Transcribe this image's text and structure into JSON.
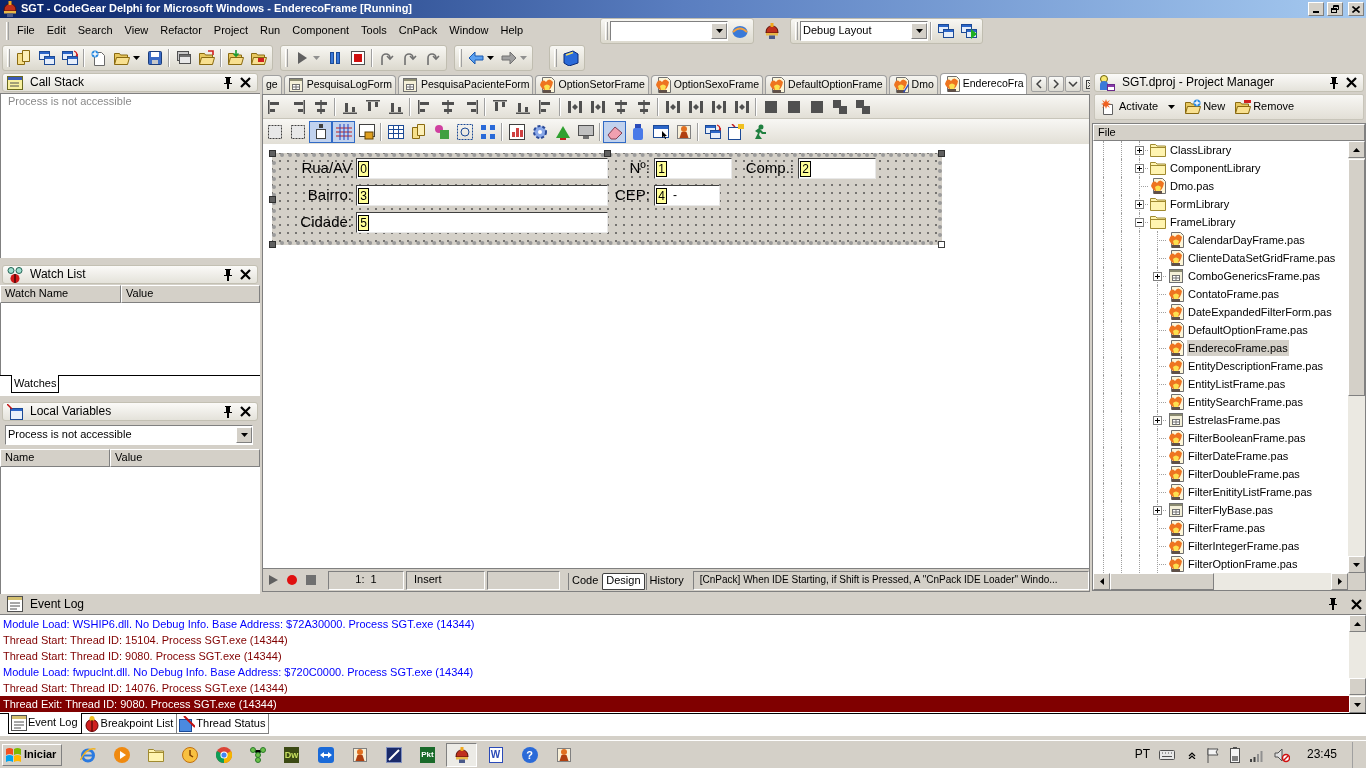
{
  "window": {
    "title": "SGT - CodeGear Delphi for Microsoft Windows - EnderecoFrame [Running]"
  },
  "menu": [
    "File",
    "Edit",
    "Search",
    "View",
    "Refactor",
    "Project",
    "Run",
    "Component",
    "Tools",
    "CnPack",
    "Window",
    "Help"
  ],
  "layout_selector": {
    "value": "Debug Layout"
  },
  "call_stack": {
    "title": "Call Stack",
    "message": "Process is not accessible"
  },
  "watch_list": {
    "title": "Watch List",
    "columns": [
      "Watch Name",
      "Value"
    ],
    "tabs": [
      {
        "label": "Watches",
        "selected": true
      }
    ]
  },
  "local_variables": {
    "title": "Local Variables",
    "scope": {
      "value": "Process is not accessible"
    },
    "columns": [
      "Name",
      "Value"
    ]
  },
  "editor_tabs": [
    {
      "label": "ge",
      "kind": "clipped",
      "selected": false
    },
    {
      "label": "PesquisaLogForm",
      "kind": "form",
      "selected": false
    },
    {
      "label": "PesquisaPacienteForm",
      "kind": "form",
      "selected": false
    },
    {
      "label": "OptionSetorFrame",
      "kind": "unit",
      "selected": false
    },
    {
      "label": "OptionSexoFrame",
      "kind": "unit",
      "selected": false
    },
    {
      "label": "DefaultOptionFrame",
      "kind": "unit",
      "selected": false
    },
    {
      "label": "Dmo",
      "kind": "datamodule",
      "selected": false
    },
    {
      "label": "EnderecoFra",
      "kind": "unit",
      "selected": true
    }
  ],
  "designer_toggles": [
    {
      "pressed": false
    },
    {
      "pressed": false
    },
    {
      "pressed": true
    },
    {
      "pressed": true
    },
    {
      "pressed": false
    },
    {
      "pressed": false
    },
    {
      "pressed": false
    },
    {
      "pressed": false
    },
    {
      "pressed": false
    },
    {
      "pressed": false
    },
    {
      "pressed": false
    },
    {
      "pressed": false
    },
    {
      "pressed": false
    },
    {
      "pressed": false
    },
    {
      "pressed": true
    },
    {
      "pressed": false
    },
    {
      "pressed": false
    },
    {
      "pressed": false
    },
    {
      "pressed": false
    },
    {
      "pressed": false
    },
    {
      "pressed": false
    }
  ],
  "form_designer": {
    "rows": [
      {
        "fields": [
          {
            "label": "Rua/AV",
            "tab_order": "0"
          },
          {
            "label": "Nº:",
            "tab_order": "1"
          },
          {
            "label": "Comp.:",
            "tab_order": "2"
          }
        ]
      },
      {
        "fields": [
          {
            "label": "Bairro:",
            "tab_order": "3"
          },
          {
            "label": "CEP:",
            "tab_order": "4",
            "value": "-"
          }
        ]
      },
      {
        "fields": [
          {
            "label": "Cidade:",
            "tab_order": "5"
          }
        ]
      }
    ]
  },
  "editor_status": {
    "position": "1:  1",
    "mode": "Insert",
    "views": [
      {
        "label": "Code",
        "selected": false
      },
      {
        "label": "Design",
        "selected": true
      },
      {
        "label": "History",
        "selected": false
      }
    ],
    "message": "[CnPack] When IDE Starting, if Shift is Pressed, A \"CnPack IDE Loader\" Windo..."
  },
  "project_manager": {
    "title": "SGT.dproj - Project Manager",
    "toolbar": [
      {
        "label": "Activate",
        "kind": "activate"
      },
      {
        "label": "New",
        "kind": "new"
      },
      {
        "label": "Remove",
        "kind": "remove"
      }
    ],
    "column": "File",
    "tree": [
      {
        "label": "ClassLibrary",
        "kind": "folder",
        "expanded": false,
        "selected": false
      },
      {
        "label": "ComponentLibrary",
        "kind": "folder",
        "expanded": false,
        "selected": false
      },
      {
        "label": "Dmo.pas",
        "kind": "unit",
        "selected": false
      },
      {
        "label": "FormLibrary",
        "kind": "folder",
        "expanded": false,
        "selected": false
      },
      {
        "label": "FrameLibrary",
        "kind": "folder",
        "expanded": true,
        "selected": false,
        "children": [
          {
            "label": "CalendarDayFrame.pas",
            "kind": "unit",
            "selected": false
          },
          {
            "label": "ClienteDataSetGridFrame.pas",
            "kind": "unit",
            "selected": false
          },
          {
            "label": "ComboGenericsFrame.pas",
            "kind": "form",
            "expanded": false,
            "selected": false
          },
          {
            "label": "ContatoFrame.pas",
            "kind": "unit",
            "selected": false
          },
          {
            "label": "DateExpandedFilterForm.pas",
            "kind": "unit",
            "selected": false
          },
          {
            "label": "DefaultOptionFrame.pas",
            "kind": "unit",
            "selected": false
          },
          {
            "label": "EnderecoFrame.pas",
            "kind": "unit",
            "selected": true
          },
          {
            "label": "EntityDescriptionFrame.pas",
            "kind": "unit",
            "selected": false
          },
          {
            "label": "EntityListFrame.pas",
            "kind": "unit",
            "selected": false
          },
          {
            "label": "EntitySearchFrame.pas",
            "kind": "unit",
            "selected": false
          },
          {
            "label": "EstrelasFrame.pas",
            "kind": "form",
            "expanded": false,
            "selected": false
          },
          {
            "label": "FilterBooleanFrame.pas",
            "kind": "unit",
            "selected": false
          },
          {
            "label": "FilterDateFrame.pas",
            "kind": "unit",
            "selected": false
          },
          {
            "label": "FilterDoubleFrame.pas",
            "kind": "unit",
            "selected": false
          },
          {
            "label": "FilterEnitityListFrame.pas",
            "kind": "unit",
            "selected": false
          },
          {
            "label": "FilterFlyBase.pas",
            "kind": "form",
            "expanded": false,
            "selected": false
          },
          {
            "label": "FilterFrame.pas",
            "kind": "unit",
            "selected": false
          },
          {
            "label": "FilterIntegerFrame.pas",
            "kind": "unit",
            "selected": false
          },
          {
            "label": "FilterOptionFrame.pas",
            "kind": "unit",
            "selected": false
          }
        ]
      }
    ]
  },
  "event_log": {
    "title": "Event Log",
    "lines": [
      {
        "text": "Module Load: WSHIP6.dll. No Debug Info. Base Address: $72A30000. Process SGT.exe (14344)",
        "color": "#0000ff",
        "selected": false
      },
      {
        "text": "Thread Start: Thread ID: 15104. Process SGT.exe (14344)",
        "color": "#800000",
        "selected": false
      },
      {
        "text": "Thread Start: Thread ID: 9080. Process SGT.exe (14344)",
        "color": "#800000",
        "selected": false
      },
      {
        "text": "Module Load: fwpuclnt.dll. No Debug Info. Base Address: $720C0000. Process SGT.exe (14344)",
        "color": "#0000ff",
        "selected": false
      },
      {
        "text": "Thread Start: Thread ID: 14076. Process SGT.exe (14344)",
        "color": "#800000",
        "selected": false
      },
      {
        "text": "Thread Exit: Thread ID: 9080. Process SGT.exe (14344)",
        "color": "#800000",
        "selected": true
      }
    ],
    "tabs": [
      {
        "label": "Event Log",
        "kind": "log",
        "selected": true
      },
      {
        "label": "Breakpoint List",
        "kind": "breakpoints",
        "selected": false
      },
      {
        "label": "Thread Status",
        "kind": "threads",
        "selected": false
      }
    ]
  },
  "taskbar": {
    "start": "Iniciar",
    "apps": [
      {
        "kind": "ring",
        "selected": false
      },
      {
        "kind": "play",
        "selected": false
      },
      {
        "kind": "folder",
        "selected": false
      },
      {
        "kind": "dial",
        "selected": false
      },
      {
        "kind": "wheel",
        "selected": false
      },
      {
        "kind": "network",
        "selected": false
      },
      {
        "kind": "olive-tile",
        "label": "Dw",
        "selected": false
      },
      {
        "kind": "arrows",
        "selected": false
      },
      {
        "kind": "figure",
        "selected": false
      },
      {
        "kind": "slash-tile",
        "selected": false
      },
      {
        "kind": "green-tile",
        "label": "Pkt",
        "selected": false
      },
      {
        "kind": "helmet",
        "selected": true
      },
      {
        "kind": "page",
        "label": "W",
        "selected": false
      },
      {
        "kind": "disc",
        "label": "?",
        "selected": false
      },
      {
        "kind": "figure",
        "selected": false
      }
    ],
    "language": "PT",
    "clock": "23:45"
  }
}
